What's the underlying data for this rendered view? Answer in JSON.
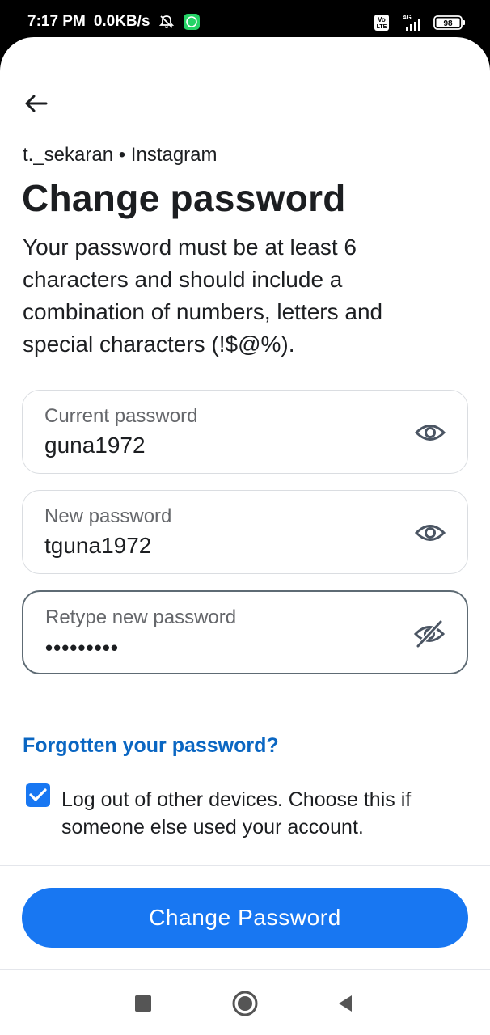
{
  "status_bar": {
    "time": "7:17 PM",
    "speed": "0.0KB/s",
    "network": "4G",
    "volte": "VoLTE",
    "battery": "98",
    "icons": [
      "mute-icon",
      "whatsapp-icon",
      "volte-icon",
      "signal-icon",
      "battery-icon"
    ]
  },
  "header": {
    "back_icon": "arrow-left-icon",
    "account": "t._sekaran • Instagram",
    "title": "Change password",
    "description": "Your password must be at least 6 characters and should include a combination of numbers, letters and special characters (!$@%)."
  },
  "fields": [
    {
      "label": "Current password",
      "value": "guna1972",
      "icon": "eye-icon"
    },
    {
      "label": "New password",
      "value": "tguna1972",
      "icon": "eye-icon"
    },
    {
      "label": "Retype new password",
      "value": "•••••••••",
      "icon": "eye-off-icon"
    }
  ],
  "forgot_link": "Forgotten your password?",
  "logout_option": {
    "checked": true,
    "text": "Log out of other devices. Choose this if someone else used your account."
  },
  "primary_button": "Change Password",
  "colors": {
    "accent": "#1877f2",
    "link": "#0a66c2",
    "text": "#1c1e21",
    "muted": "#65676b",
    "border": "#dadde1"
  },
  "nav_bar": [
    "recents-square-icon",
    "home-circle-icon",
    "back-triangle-icon"
  ]
}
